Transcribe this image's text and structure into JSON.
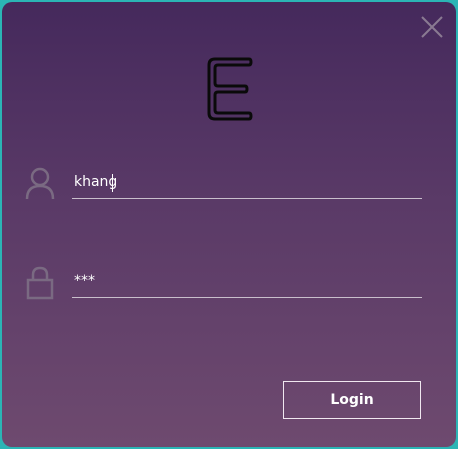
{
  "window": {
    "gradient_top": "#45295c",
    "gradient_bottom": "#6e4a6f",
    "border_color": "#2bb5b5"
  },
  "close": {
    "icon": "close-icon"
  },
  "logo": {
    "icon": "e-logo-icon"
  },
  "username": {
    "icon": "user-icon",
    "value": "khang"
  },
  "password": {
    "icon": "lock-icon",
    "value": "***"
  },
  "login": {
    "label": "Login"
  }
}
